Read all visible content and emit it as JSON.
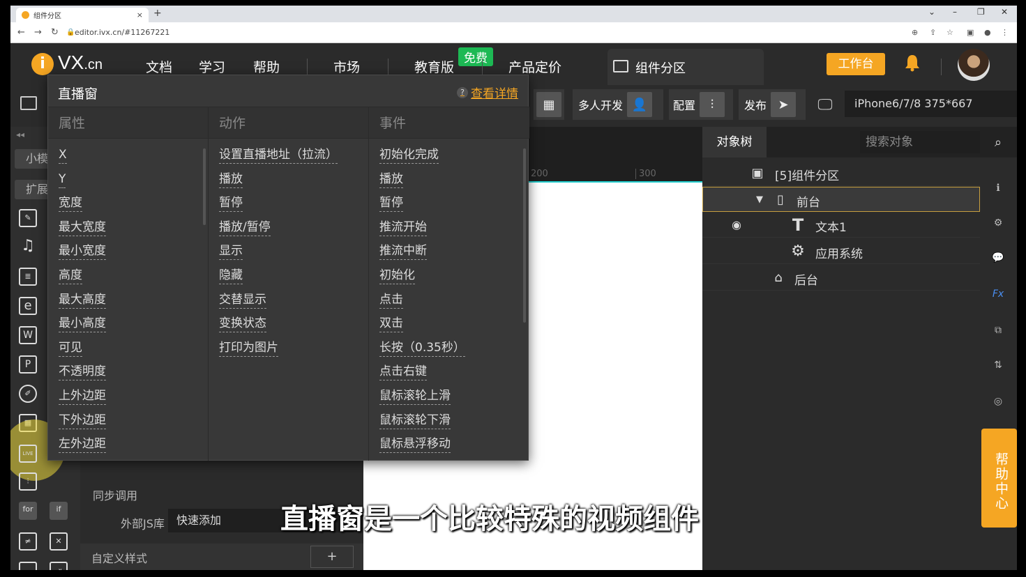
{
  "browser": {
    "tab_title": "组件分区",
    "tab_close": "×",
    "new_tab": "+",
    "url": "editor.ivx.cn/#11267221",
    "window_controls": [
      "⌄",
      "–",
      "❐",
      "✕"
    ]
  },
  "header": {
    "logo_letter": "i",
    "logo_brand": "VX",
    "logo_tld": ".cn",
    "nav": [
      "文档",
      "学习",
      "帮助",
      "市场",
      "教育版",
      "产品定价"
    ],
    "free_badge": "免费",
    "component_tab": "组件分区",
    "workbench": "工作台"
  },
  "toolbar": {
    "multi_dev": "多人开发",
    "config": "配置",
    "publish": "发布",
    "device": "iPhone6/7/8 375*667"
  },
  "left_sidebar": {
    "pill_small": "小模",
    "pill_ext": "扩展组",
    "for_label": "for",
    "if_label": "if",
    "live_label": "LIVE"
  },
  "middle_panel": {
    "sync_call": "同步调用",
    "external_js_label": "外部JS库",
    "external_js_value": "快速添加",
    "custom_style": "自定义样式",
    "plus": "+"
  },
  "canvas": {
    "ruler_marks": [
      "200",
      "300"
    ]
  },
  "object_tree": {
    "title": "对象树",
    "search_placeholder": "搜索对象",
    "nodes": [
      "[5]组件分区",
      "前台",
      "文本1",
      "应用系统",
      "后台"
    ]
  },
  "help_center": "帮助中心",
  "popup": {
    "title": "直播窗",
    "help_link": "查看详情",
    "columns": [
      {
        "head": "属性",
        "items": [
          "X",
          "Y",
          "宽度",
          "最大宽度",
          "最小宽度",
          "高度",
          "最大高度",
          "最小高度",
          "可见",
          "不透明度",
          "上外边距",
          "下外边距",
          "左外边距"
        ]
      },
      {
        "head": "动作",
        "items": [
          "设置直播地址（拉流）",
          "播放",
          "暂停",
          "播放/暂停",
          "显示",
          "隐藏",
          "交替显示",
          "变换状态",
          "打印为图片"
        ]
      },
      {
        "head": "事件",
        "items": [
          "初始化完成",
          "播放",
          "暂停",
          "推流开始",
          "推流中断",
          "初始化",
          "点击",
          "双击",
          "长按（0.35秒）",
          "点击右键",
          "鼠标滚轮上滑",
          "鼠标滚轮下滑",
          "鼠标悬浮移动"
        ]
      }
    ]
  },
  "subtitle": "直播窗是一个比较特殊的视频组件",
  "colors": {
    "accent": "#f5a623",
    "free_badge": "#1db954",
    "background": "#2b2b2b"
  }
}
